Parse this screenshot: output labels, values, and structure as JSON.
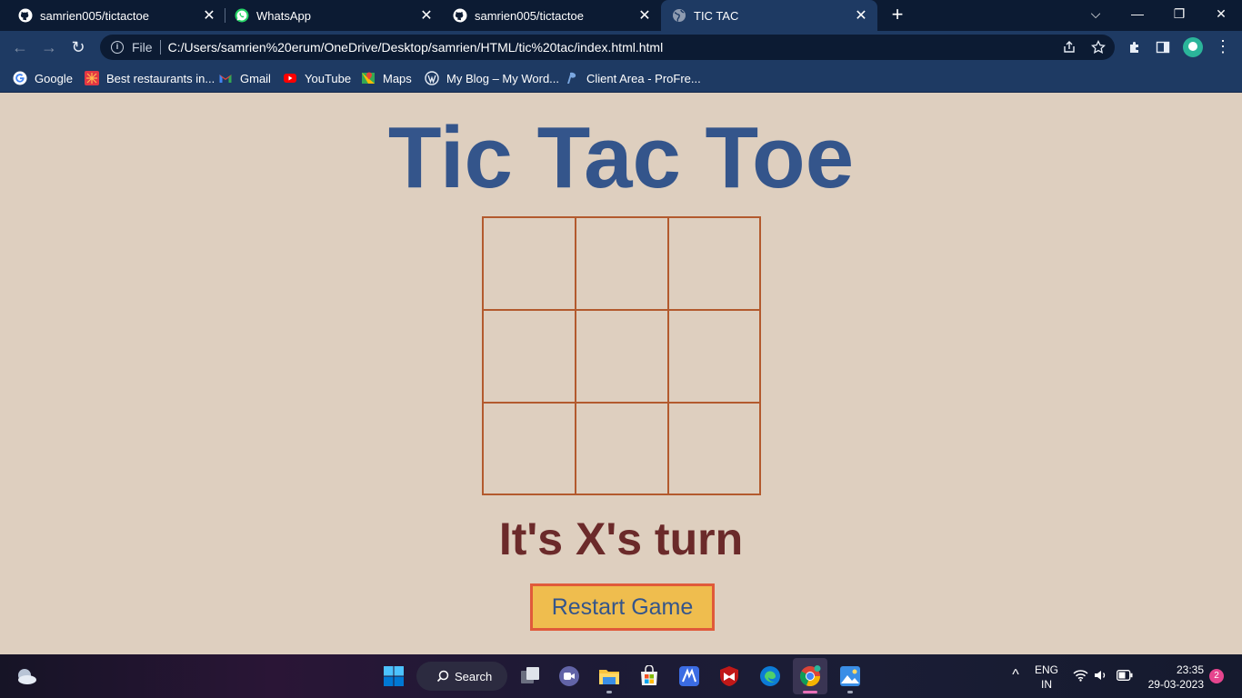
{
  "browser": {
    "tabs": [
      {
        "title": "samrien005/tictactoe",
        "icon": "github-icon",
        "active": false
      },
      {
        "title": "WhatsApp",
        "icon": "whatsapp-icon",
        "active": false
      },
      {
        "title": "samrien005/tictactoe",
        "icon": "github-icon",
        "active": false
      },
      {
        "title": "TIC TAC",
        "icon": "globe-icon",
        "active": true
      }
    ],
    "new_tab": "+",
    "address": {
      "scheme": "File",
      "url": "C:/Users/samrien%20erum/OneDrive/Desktop/samrien/HTML/tic%20tac/index.html.html"
    },
    "bookmarks": [
      {
        "label": "Google",
        "icon": "google-icon"
      },
      {
        "label": "Best restaurants in...",
        "icon": "zomato-icon"
      },
      {
        "label": "Gmail",
        "icon": "gmail-icon"
      },
      {
        "label": "YouTube",
        "icon": "youtube-icon"
      },
      {
        "label": "Maps",
        "icon": "maps-icon"
      },
      {
        "label": "My Blog – My Word...",
        "icon": "wordpress-icon"
      },
      {
        "label": "Client Area - ProFre...",
        "icon": "profreehost-icon"
      }
    ]
  },
  "game": {
    "title": "Tic Tac Toe",
    "board": [
      "",
      "",
      "",
      "",
      "",
      "",
      "",
      "",
      ""
    ],
    "status": "It's X's turn",
    "restart_label": "Restart Game"
  },
  "taskbar": {
    "search_label": "Search",
    "language_line1": "ENG",
    "language_line2": "IN",
    "time": "23:35",
    "date": "29-03-2023",
    "notification_count": "2"
  },
  "colors": {
    "page_background": "#decfbf",
    "title": "#34558b",
    "grid_lines": "#b35a2e",
    "status_text": "#6b2a2a",
    "button_fill": "#efbd4e",
    "button_border": "#e05a3a"
  }
}
